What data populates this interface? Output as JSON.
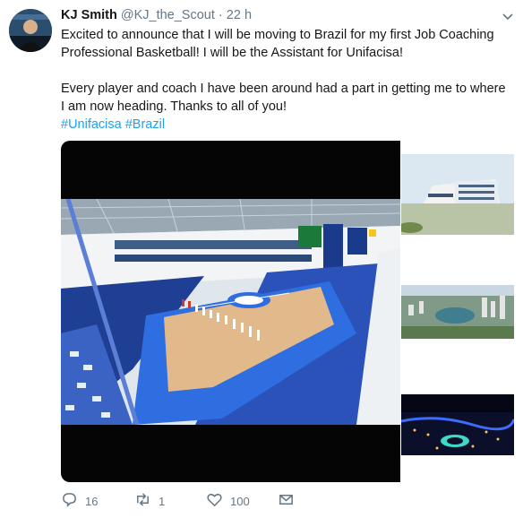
{
  "tweet": {
    "author_name": "KJ Smith",
    "handle": "@KJ_the_Scout",
    "separator": "·",
    "time": "22 h",
    "text_para1": "Excited to announce that I will be moving to Brazil for my first Job Coaching Professional Basketball! I will be the Assistant for Unifacisa!",
    "text_para2": "Every player and coach I have been around had a part in getting me to where I am now heading. Thanks to all of you!",
    "hashtags": "#Unifacisa #Brazil",
    "icons": {
      "caret": "chevron-down-icon",
      "reply": "reply-icon",
      "retweet": "retweet-icon",
      "like": "heart-icon",
      "dm": "envelope-icon"
    }
  },
  "actions": {
    "reply_count": "16",
    "retweet_count": "1",
    "like_count": "100"
  },
  "colors": {
    "link": "#1da1f2",
    "secondary_text": "#657786",
    "court_blue": "#1f5fd0"
  }
}
